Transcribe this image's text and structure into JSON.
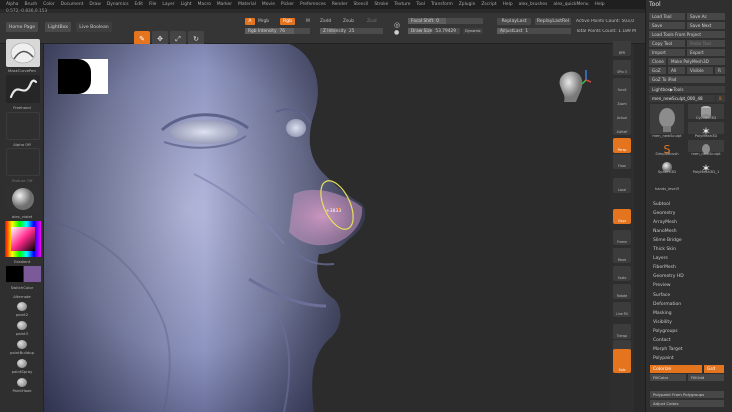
{
  "menu": [
    "Alpha",
    "Brush",
    "Color",
    "Document",
    "Draw",
    "Dynamics",
    "Edit",
    "File",
    "Layer",
    "Light",
    "Macro",
    "Marker",
    "Material",
    "Movie",
    "Picker",
    "Preferences",
    "Render",
    "Stencil",
    "Stroke",
    "Texture",
    "Tool",
    "Transform",
    "Zplugin",
    "Zscript",
    "Help",
    "alex_brushes",
    "alex_quickMenu",
    "Help"
  ],
  "coords": "0.572,-0.836,0.153",
  "top": {
    "home_page": "Home Page",
    "lightbox": "LightBox",
    "live_boolean": "Live Boolean",
    "tools": [
      {
        "label": "Draw",
        "glyph": "✎",
        "active": true
      },
      {
        "label": "Move",
        "glyph": "✥",
        "active": false
      },
      {
        "label": "Scale",
        "glyph": "⤢",
        "active": false
      },
      {
        "label": "Rotate",
        "glyph": "↻",
        "active": false
      }
    ],
    "a_label": "A",
    "mrgb": "Mrgb",
    "rgb": "Rgb",
    "m": "M",
    "zadd": "Zadd",
    "zsub": "Zsub",
    "zcut": "Zcut",
    "rgb_intensity": {
      "label": "Rgb Intensity",
      "value": "76",
      "level": 0.76
    },
    "z_intensity": {
      "label": "Z Intensity",
      "value": "25",
      "level": 0.25
    },
    "focal_shift": {
      "label": "Focal Shift",
      "value": "0",
      "level": 0.5
    },
    "draw_size": {
      "label": "Draw Size",
      "value": "53.79429",
      "level": 0.45
    },
    "dynamic": "Dynamic",
    "replay_last": "ReplayLast",
    "replay_last_rel": "ReplayLastRel",
    "adjust_last": {
      "label": "AdjustLast",
      "value": "1"
    },
    "active_points": "Active Points Count: 503,0",
    "total_points": "Total Points Count: 1.189 M"
  },
  "left": {
    "brush_name": "MaskCurvePen",
    "stroke_name": "Freehand",
    "alpha_name": "Alpha Off",
    "texture_name": "Texture Off",
    "material_name": "alex_violet",
    "gradient": "Gradient",
    "switch_color": "SwitchColor",
    "alternate": "Alternate",
    "paints": [
      "paint2",
      "paint3",
      "paintBuildup",
      "paintSpray",
      "PaintHook"
    ]
  },
  "right_shelf": [
    {
      "label": "BPR",
      "active": false
    },
    {
      "label": "SPix 3",
      "active": false
    },
    {
      "label": "Scroll",
      "active": false
    },
    {
      "label": "Zoom",
      "active": false
    },
    {
      "label": "Actual",
      "active": false
    },
    {
      "label": "AAHalf",
      "active": false
    },
    {
      "label": "Persp",
      "active": true
    },
    {
      "label": "Floor",
      "active": false
    },
    {
      "label": "Local",
      "active": false
    },
    {
      "label": "Gxyz",
      "active": true
    },
    {
      "label": "Frame",
      "active": false
    },
    {
      "label": "Move",
      "active": false
    },
    {
      "label": "Scale",
      "active": false
    },
    {
      "label": "Rotate",
      "active": false
    },
    {
      "label": "Line Fill",
      "active": false
    },
    {
      "label": "Transp",
      "active": false
    },
    {
      "label": "Ghost",
      "active": false
    },
    {
      "label": "Solo",
      "active": true
    }
  ],
  "right_caps": {
    "dynamic": "Dynamic",
    "xpose": "Xpose"
  },
  "brush_cursor": "+3833",
  "panel": {
    "title": "Tool",
    "load_tool": "Load Tool",
    "save_as": "Save As",
    "save": "Save",
    "save_next": "Save Next",
    "load_from_project": "Load Tools From Project",
    "copy_tool": "Copy Tool",
    "paste_tool": "Paste Tool",
    "import": "Import",
    "export": "Export",
    "clone": "Clone",
    "make_polymesh": "Make PolyMesh3D",
    "goz": "GoZ",
    "all": "All",
    "visible": "Visible",
    "r": "R",
    "goz_photoshop": "GoZ To iPad",
    "lightbox_tools": "Lightbox▶Tools",
    "current_tool": "men_newSculpt_000_48",
    "current_count": "8",
    "thumbs": [
      {
        "name": "men_newSculpt"
      },
      {
        "name": "Cylinder3D"
      },
      {
        "name": "PolyMesh3D"
      },
      {
        "name": "SimpleBrush"
      },
      {
        "name": "men_newSculpt"
      },
      {
        "name": "Sphere3D"
      },
      {
        "name": "PolyMesh3D_1"
      }
    ],
    "handle": "hands_level3",
    "items": [
      {
        "label": "Subtool",
        "active": false
      },
      {
        "label": "Geometry",
        "active": false
      },
      {
        "label": "ArrayMesh",
        "active": false
      },
      {
        "label": "NanoMesh",
        "active": false
      },
      {
        "label": "Slime Bridge",
        "active": false
      },
      {
        "label": "Thick Skin",
        "active": false
      },
      {
        "label": "Layers",
        "active": false
      },
      {
        "label": "FiberMesh",
        "active": false
      },
      {
        "label": "Geometry HD",
        "active": false
      },
      {
        "label": "Preview",
        "active": false
      },
      {
        "label": "Surface",
        "active": false
      },
      {
        "label": "Deformation",
        "active": false
      },
      {
        "label": "Masking",
        "active": false
      },
      {
        "label": "Visibility",
        "active": false
      },
      {
        "label": "Polygroups",
        "active": false
      },
      {
        "label": "Contact",
        "active": false
      },
      {
        "label": "Morph Target",
        "active": false
      },
      {
        "label": "Polypaint",
        "active": false
      }
    ],
    "colorize": "Colorize",
    "grd": "Grd",
    "fill_color": "FillColor",
    "fill_odd": "FillOdd",
    "polypaint_from_polygroups": "Polypaint From Polygroups",
    "adjust_colors": "Adjust Colors"
  },
  "colors": {
    "accent": "#e5741f",
    "skin": "#9ea3c8",
    "nose": "#c88fb6",
    "bg": "#2b2b2b"
  }
}
